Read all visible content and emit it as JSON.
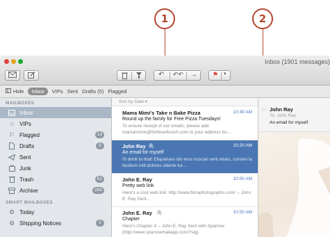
{
  "callouts": [
    {
      "label": "1"
    },
    {
      "label": "2"
    }
  ],
  "window": {
    "title": "Inbox (1901 messages)",
    "traffic_colors": [
      "#e0443e",
      "#dea123",
      "#1aab29"
    ]
  },
  "favorites_bar": {
    "hide_label": "Hide",
    "items": [
      "Inbox",
      "VIPs",
      "Sent",
      "Drafts (5)",
      "Flagged"
    ]
  },
  "sidebar": {
    "mailboxes_header": "MAILBOXES",
    "items": [
      {
        "label": "Inbox",
        "icon": "inbox-icon",
        "badge": ""
      },
      {
        "label": "VIPs",
        "icon": "star-icon",
        "badge": ""
      },
      {
        "label": "Flagged",
        "icon": "flag-icon",
        "badge": "13"
      },
      {
        "label": "Drafts",
        "icon": "document-icon",
        "badge": "5"
      },
      {
        "label": "Sent",
        "icon": "paper-plane-icon",
        "badge": ""
      },
      {
        "label": "Junk",
        "icon": "junk-icon",
        "badge": ""
      },
      {
        "label": "Trash",
        "icon": "trash-icon",
        "badge": "51"
      },
      {
        "label": "Archive",
        "icon": "archive-icon",
        "badge": "283"
      }
    ],
    "smart_header": "SMART MAILBOXES",
    "smart_items": [
      {
        "label": "Today",
        "icon": "gear-icon",
        "badge": ""
      },
      {
        "label": "Shipping Notices",
        "icon": "gear-icon",
        "badge": "2"
      }
    ]
  },
  "message_list": {
    "sort_label": "Sort by Date ▾",
    "messages": [
      {
        "from": "Mama Mimi's Take n Bake Pizza",
        "time": "10:49 AM",
        "subject": "Round up the family for Free Pizza Tuesdays!",
        "preview": "To ensure receipt of our emails, please add mamamimis@fishbowltouch.com to your address bo..."
      },
      {
        "from": "John Ray",
        "time": "10:20 AM",
        "subject": "An email for myself",
        "preview": "I'll drink to that! Eliquatueo dio eros nuscan vent etiam, consen la facilium inilt dolores ullame tur..."
      },
      {
        "from": "John E. Ray",
        "time": "10:00 AM",
        "subject": "Pretty web link",
        "preview": "Here's a cool web link: http://www.floraphotographs.com/ -- John E. Ray Sent..."
      },
      {
        "from": "John E. Ray",
        "time": "10:00 AM",
        "subject": "Chapter",
        "preview": "Here's Chapter 4 -- John E. Ray Sent with Sparrow (http://www.sparrowmailapp.com/?sig)"
      }
    ]
  },
  "preview": {
    "from": "John Ray",
    "to": "To: John Ray",
    "subject": "An email for myself"
  },
  "colors": {
    "accent": "#4a77b3",
    "callout": "#b5452f",
    "sidebar_bg": "#e3e7ec"
  }
}
